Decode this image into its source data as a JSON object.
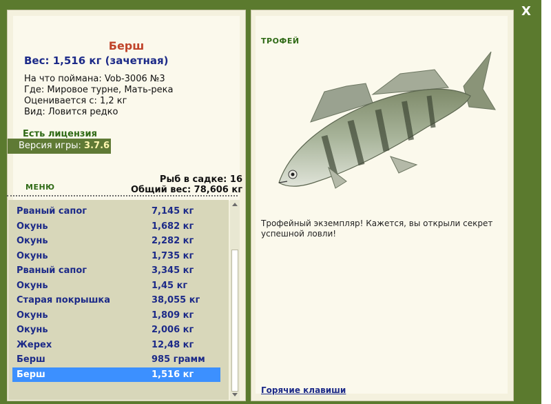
{
  "window": {
    "close_label": "X"
  },
  "fish": {
    "name": "Берш",
    "weight_line": "Вес: 1,516 кг (зачетная)",
    "bait_line": "На что поймана: Vob-3006 №3",
    "where_line": "Где: Мировое турне, Мать-река",
    "value_line": "Оценивается с: 1,2 кг",
    "type_line": "Вид: Ловится редко"
  },
  "license": "Есть лицензия",
  "version": {
    "label": "Версия игры:",
    "value": "3.7.6"
  },
  "menu_label": "МЕНЮ",
  "keepnet": {
    "count_line": "Рыб в садке: 16",
    "total_line": "Общий вес: 78,606 кг"
  },
  "catch_list": [
    {
      "name": "Рваный сапог",
      "weight": "7,145 кг"
    },
    {
      "name": "Окунь",
      "weight": "1,682 кг"
    },
    {
      "name": "Окунь",
      "weight": "2,282 кг"
    },
    {
      "name": "Окунь",
      "weight": "1,735 кг"
    },
    {
      "name": "Рваный сапог",
      "weight": "3,345 кг"
    },
    {
      "name": "Окунь",
      "weight": "1,45 кг"
    },
    {
      "name": "Старая покрышка",
      "weight": "38,055 кг"
    },
    {
      "name": "Окунь",
      "weight": "1,809 кг"
    },
    {
      "name": "Окунь",
      "weight": "2,006 кг"
    },
    {
      "name": "Жерех",
      "weight": "12,48 кг"
    },
    {
      "name": "Берш",
      "weight": "985 грамм"
    },
    {
      "name": "Берш",
      "weight": "1,516 кг",
      "selected": true
    }
  ],
  "trophy": {
    "label": "ТРОФЕЙ",
    "text": "Трофейный экземпляр! Кажется, вы открыли секрет успешной ловли!"
  },
  "hotkeys_label": "Горячие клавиши",
  "colors": {
    "frame": "#5b7a2e",
    "accent_green": "#2f6a16",
    "list_text": "#1c2a88",
    "selection": "#3c90ff",
    "fish_name": "#c0442a"
  }
}
